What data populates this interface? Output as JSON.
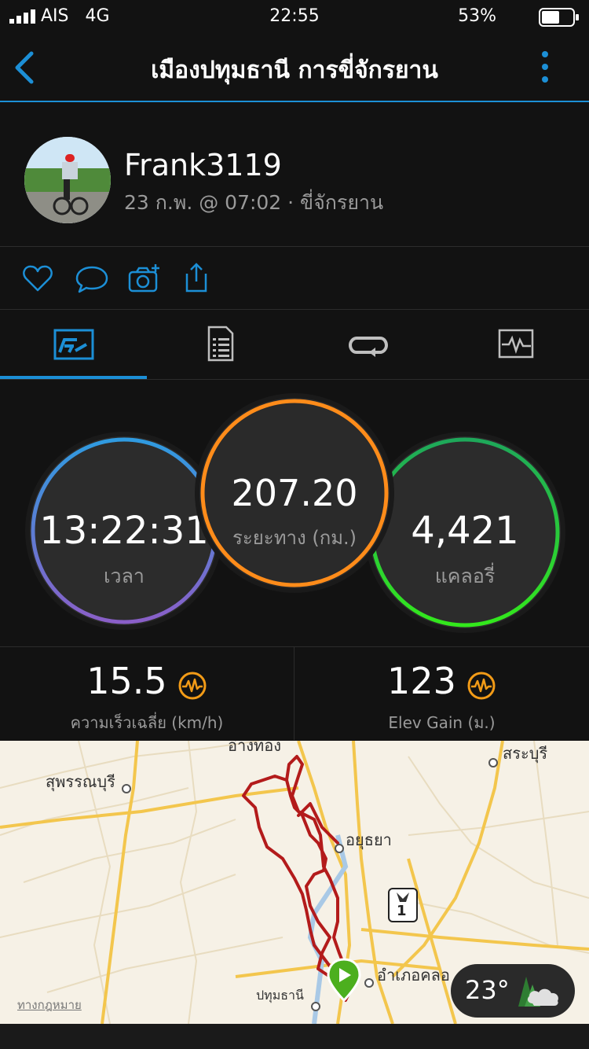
{
  "status_bar": {
    "carrier": "AIS   4G",
    "time": "22:55",
    "battery": "53%"
  },
  "nav": {
    "title": "เมืองปทุมธานี การขี่จักรยาน"
  },
  "activity": {
    "user": "Frank3119",
    "meta": "23 ก.พ. @ 07:02 · ขี่จักรยาน"
  },
  "stats": {
    "time": {
      "value": "13:22:31",
      "label": "เวลา"
    },
    "distance": {
      "value": "207.20",
      "label": "ระยะทาง (กม.)"
    },
    "calories": {
      "value": "4,421",
      "label": "แคลอรี่"
    }
  },
  "metrics": {
    "speed": {
      "value": "15.5",
      "label": "ความเร็วเฉลี่ย (km/h)"
    },
    "elev": {
      "value": "123",
      "label": "Elev Gain (ม.)"
    }
  },
  "map": {
    "labels": {
      "top": "อ่างทอง",
      "suphan": "สุพรรณบุรี",
      "saraburi": "สระบุรี",
      "ayutthaya": "อยุธยา",
      "khlong": "อำเภอคลอ",
      "pathum": "ปทุมธานี",
      "legal": "ทางกฎหมาย",
      "route_shield": "1"
    },
    "weather_temp": "23°"
  },
  "colors": {
    "accent": "#1c8fd6",
    "time_ring": "#3a8fe0",
    "distance_ring": "#ff8c1a",
    "calories_ring": "#22cc33",
    "route": "#b31b1b"
  }
}
